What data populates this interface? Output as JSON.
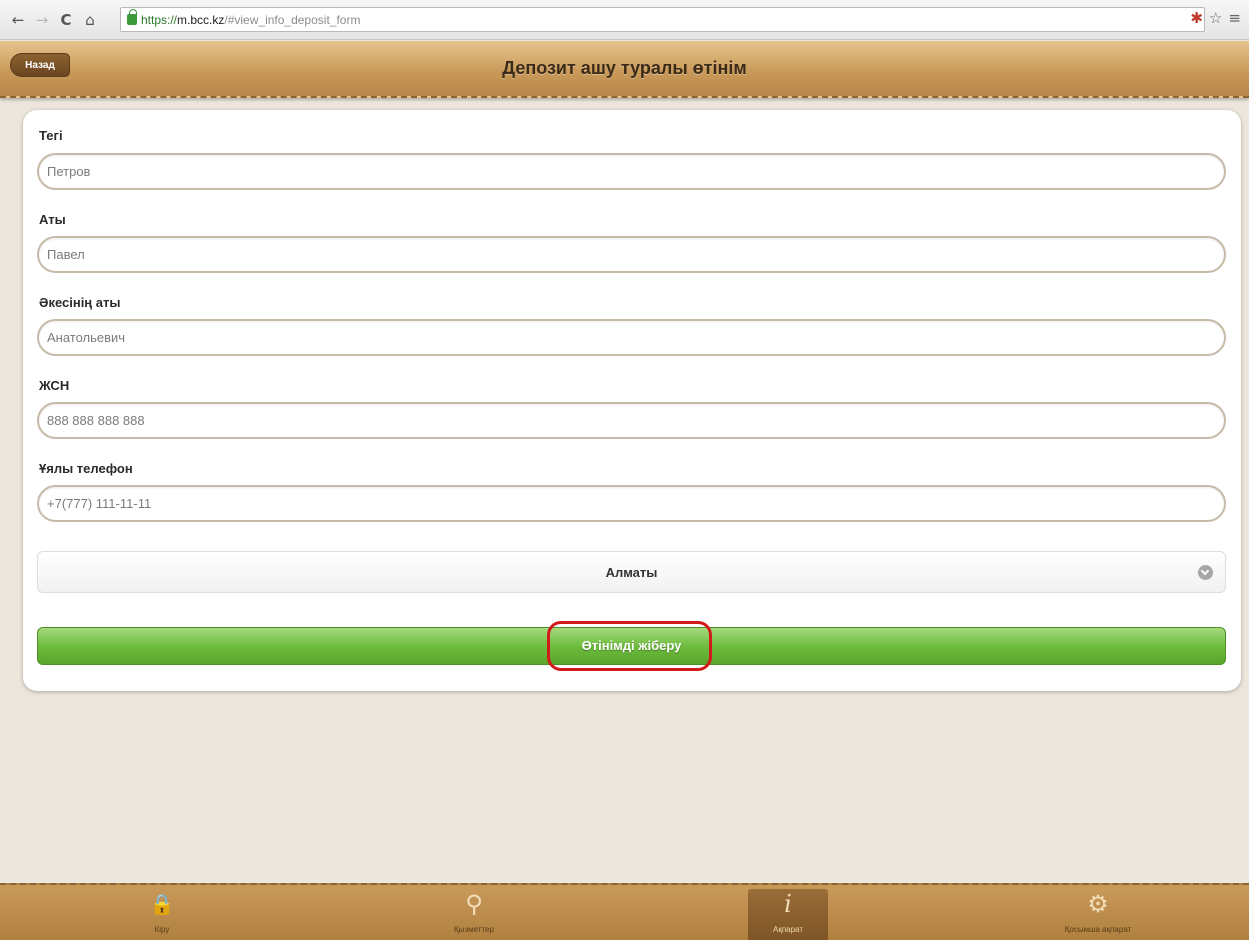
{
  "browser": {
    "url_scheme": "https://",
    "url_host": "m.bcc.kz",
    "url_rest": "/#view_info_deposit_form",
    "back_glyph": "←",
    "forward_glyph": "→",
    "reload_glyph": "C",
    "home_glyph": "⌂",
    "ext_glyph": "✱",
    "star_glyph": "☆",
    "menu_glyph": "≡"
  },
  "header": {
    "back_label": "Назад",
    "title": "Депозит ашу туралы өтінім"
  },
  "form": {
    "surname": {
      "label": "Тегі",
      "value": "Петров"
    },
    "name": {
      "label": "Аты",
      "value": "Павел"
    },
    "patronymic": {
      "label": "Әкесінің аты",
      "value": "Анатольевич"
    },
    "iin": {
      "label": "ЖСН",
      "value": "888 888 888 888"
    },
    "phone": {
      "label": "Ұялы телефон",
      "value": "+7(777) 111-11-11"
    },
    "city": {
      "selected": "Алматы"
    },
    "submit_label": "Өтінімді жіберу"
  },
  "tabs": [
    {
      "icon": "lock-icon",
      "glyph": "🔒",
      "label": "Кіру"
    },
    {
      "icon": "map-pin-icon",
      "glyph": "⚲",
      "label": "Қызметтер"
    },
    {
      "icon": "info-icon",
      "glyph": "i",
      "label": "Ақпарат"
    },
    {
      "icon": "gear-icon",
      "glyph": "⚙",
      "label": "Қосымша ақпарат"
    }
  ],
  "colors": {
    "header_gradient_top": "#e8c48e",
    "submit_green": "#6fbd3f",
    "highlight_red": "#d21a1a",
    "page_bg": "#ece6dc"
  }
}
